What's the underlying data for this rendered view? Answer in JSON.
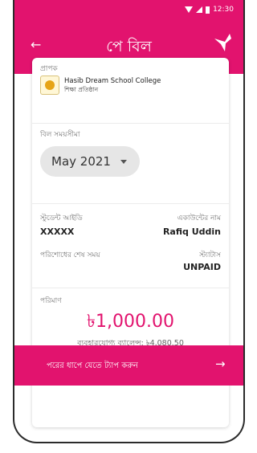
{
  "status_bar": {
    "time": "12:30"
  },
  "header": {
    "back_icon": "arrow-left-icon",
    "title": "পে বিল",
    "logo_icon": "bird-icon"
  },
  "receiver": {
    "label": "প্রাপক",
    "name": "Hasib Dream School College",
    "subtitle": "শিক্ষা প্রতিষ্ঠান"
  },
  "bill_period": {
    "label": "বিল সময়সীমা",
    "selected": "May 2021"
  },
  "details": {
    "student_id_label": "স্টুডেন্ট আইডি",
    "student_id_value": "XXXXX",
    "account_name_label": "একাউন্টের নাম",
    "account_name_value": "Rafiq Uddin",
    "deadline_label": "পরিশোধের শেষ সময়",
    "status_label": "স্ট্যাটাস",
    "status_value": "UNPAID"
  },
  "amount": {
    "label": "পরিমাণ",
    "value": "৳1,000.00",
    "balance": "ব্যবহারযোগ্য ব্যালেন্স: ৳4,080.50"
  },
  "cta": {
    "label": "পরের ধাপে যেতে ট্যাপ করুন",
    "arrow_icon": "arrow-right-icon"
  },
  "colors": {
    "accent": "#e2136e"
  }
}
